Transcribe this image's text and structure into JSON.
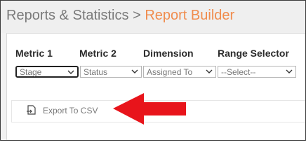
{
  "breadcrumb": {
    "parent": "Reports & Statistics",
    "separator": ">",
    "current": "Report Builder"
  },
  "form": {
    "labels": [
      "Metric 1",
      "Metric 2",
      "Dimension",
      "Range Selector"
    ],
    "selects": [
      {
        "value": "Stage",
        "focused": true
      },
      {
        "value": "Status"
      },
      {
        "value": "Assigned To"
      },
      {
        "value": "--Select--"
      }
    ]
  },
  "toolbar": {
    "export_label": "Export To CSV",
    "export_icon": "export-icon"
  },
  "annotation": {
    "arrow_color": "#e8141b"
  },
  "colors": {
    "breadcrumb_current": "#f08c4d",
    "breadcrumb_parent": "#7a7a7a"
  }
}
